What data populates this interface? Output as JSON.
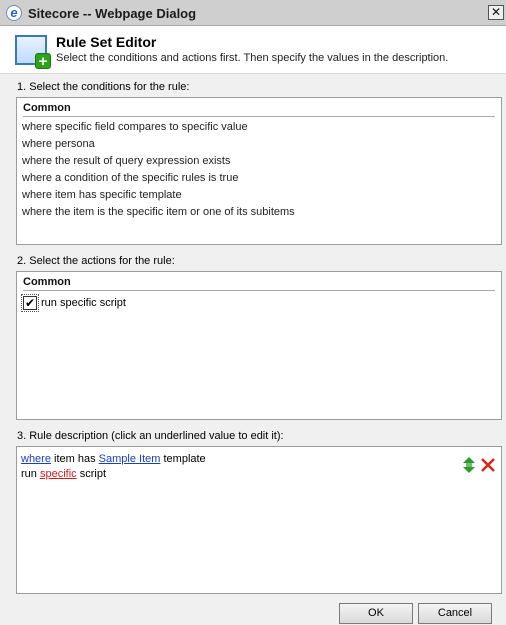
{
  "window": {
    "title": "Sitecore -- Webpage Dialog",
    "close_glyph": "✕"
  },
  "header": {
    "title": "Rule Set Editor",
    "subtitle": "Select the conditions and actions first. Then specify the values in the description.",
    "icon": "rule-editor-add-icon"
  },
  "conditions": {
    "label": "1. Select the conditions for the rule:",
    "group": "Common",
    "items": [
      "where specific field compares to specific value",
      "where persona",
      "where the result of query expression exists",
      "where a condition of the specific rules is true",
      "where item has specific template",
      "where the item is the specific item or one of its subitems"
    ]
  },
  "actions": {
    "label": "2. Select the actions for the rule:",
    "group": "Common",
    "items": [
      {
        "label": "run specific script",
        "checked": true,
        "check_glyph": "✔"
      }
    ]
  },
  "description": {
    "label": "3. Rule description (click an underlined value to edit it):",
    "line1": {
      "link1": "where",
      "text1": "item has",
      "link2": "Sample Item",
      "text2": "template"
    },
    "line2": {
      "text1": "run",
      "link1": "specific",
      "text2": "script"
    },
    "icons": [
      "move-up-down-icon",
      "delete-icon"
    ]
  },
  "buttons": {
    "ok": "OK",
    "cancel": "Cancel"
  },
  "colors": {
    "link": "#1a3fbd",
    "link_red": "#d61a1a",
    "background": "#f0f0f0"
  }
}
